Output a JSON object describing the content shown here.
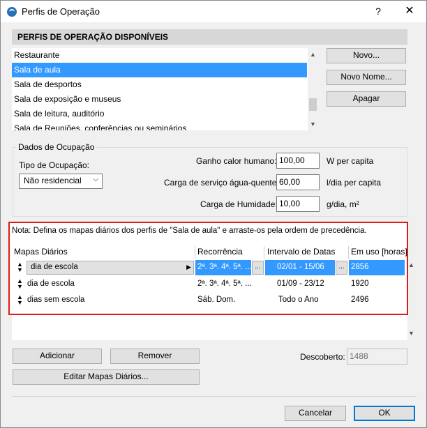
{
  "window": {
    "title": "Perfis de Operação",
    "help": "?",
    "close": "✕"
  },
  "section": {
    "header": "PERFIS DE OPERAÇÃO DISPONÍVEIS"
  },
  "profiles": [
    "Restaurante",
    "Sala de aula",
    "Sala de desportos",
    "Sala de exposição e museus",
    "Sala de leitura, auditório",
    "Sala de Reuniões, conferências ou seminários"
  ],
  "profile_buttons": {
    "new": "Novo...",
    "new_name": "Novo Nome...",
    "delete": "Apagar"
  },
  "occupancy": {
    "title": "Dados de Ocupação",
    "type_label": "Tipo de Ocupação:",
    "type_value": "Não residencial",
    "heat_label": "Ganho calor humano:",
    "heat_value": "100,00",
    "heat_unit": "W per capita",
    "water_label": "Carga de serviço água-quente:",
    "water_value": "60,00",
    "water_unit": "l/dia per capita",
    "humidity_label": "Carga de Humidade:",
    "humidity_value": "10,00",
    "humidity_unit": "g/dia, m²"
  },
  "schedules": {
    "note": "Nota: Defina os mapas diários dos perfis de  \"Sala de aula\" e arraste-os pela ordem de precedência.",
    "columns": [
      "Mapas Diários",
      "Recorrência",
      "Intervalo de Datas",
      "Em uso [horas]"
    ],
    "rows": [
      {
        "map": "dia de escola",
        "recurrence": "2ª. 3ª. 4ª. 5ª. ...",
        "interval": "02/01 - 15/06",
        "hours": "2856"
      },
      {
        "map": "dia de escola",
        "recurrence": "2ª. 3ª. 4ª. 5ª. ...",
        "interval": "01/09 - 23/12",
        "hours": "1920"
      },
      {
        "map": "dias sem escola",
        "recurrence": "Sáb. Dom.",
        "interval": "Todo o Ano",
        "hours": "2496"
      }
    ],
    "dots": "..."
  },
  "actions": {
    "add": "Adicionar",
    "remove": "Remover",
    "edit_maps": "Editar Mapas Diários...",
    "uncovered_label": "Descoberto:",
    "uncovered_value": "1488"
  },
  "footer": {
    "cancel": "Cancelar",
    "ok": "OK"
  },
  "colors": {
    "selection": "#3399ff",
    "highlight_border": "#e01a1a",
    "primary_border": "#0078d7"
  }
}
